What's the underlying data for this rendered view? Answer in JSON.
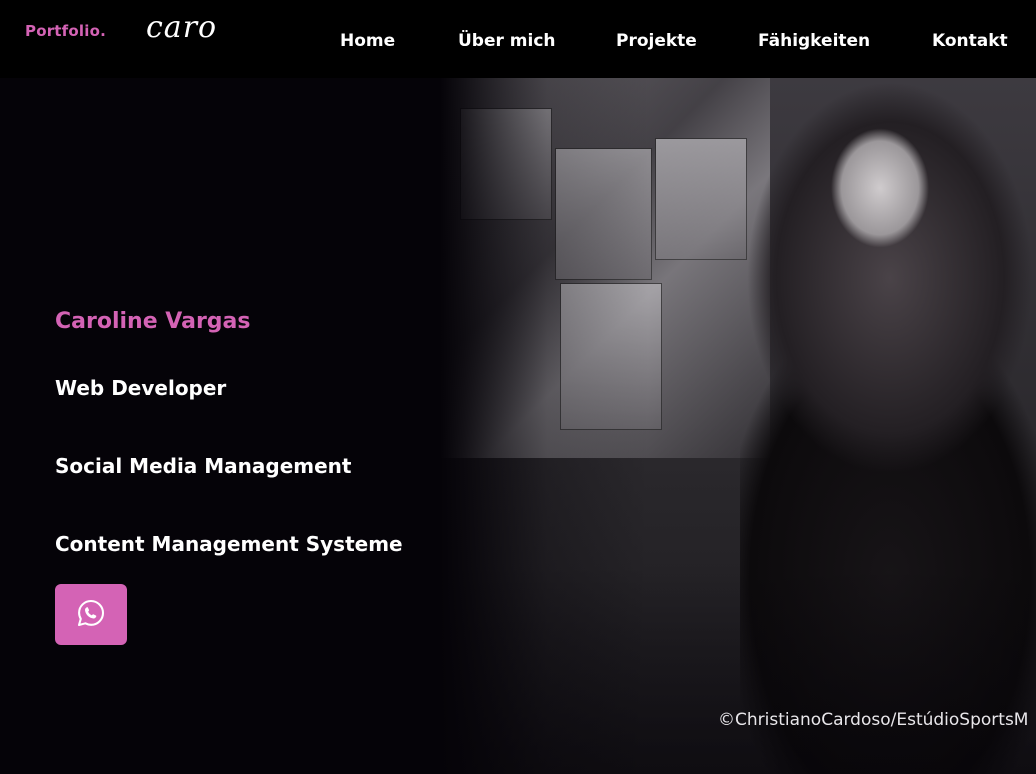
{
  "header": {
    "logo": "Portfolio.",
    "brand": "caro",
    "nav": [
      "Home",
      "Über mich",
      "Projekte",
      "Fähigkeiten",
      "Kontakt"
    ]
  },
  "hero": {
    "name": "Caroline Vargas",
    "skills": [
      "Web Developer",
      "Social Media Management",
      "Content Management Systeme"
    ],
    "contact_icon": "whatsapp-icon",
    "photo_credit": "©ChristianoCardoso/EstúdioSportsM"
  },
  "colors": {
    "accent": "#d463b5",
    "background": "#050308",
    "header": "#000000",
    "text": "#ffffff"
  }
}
